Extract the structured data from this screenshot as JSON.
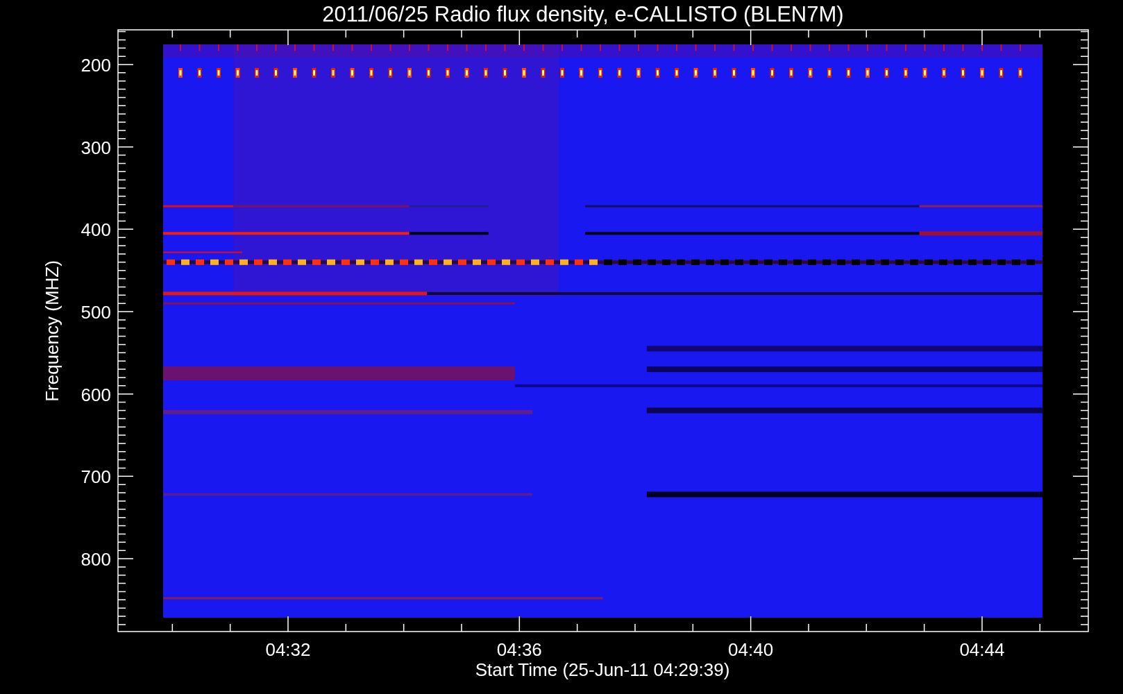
{
  "title": "2011/06/25  Radio flux density, e-CALLISTO (BLEN7M)",
  "y_axis": {
    "label": "Frequency (MHZ)",
    "ticks": [
      "200",
      "300",
      "400",
      "500",
      "600",
      "700",
      "800"
    ]
  },
  "x_axis": {
    "label": "Start Time (25-Jun-11 04:29:39)",
    "ticks": [
      "04:32",
      "04:36",
      "04:40",
      "04:44"
    ]
  }
}
